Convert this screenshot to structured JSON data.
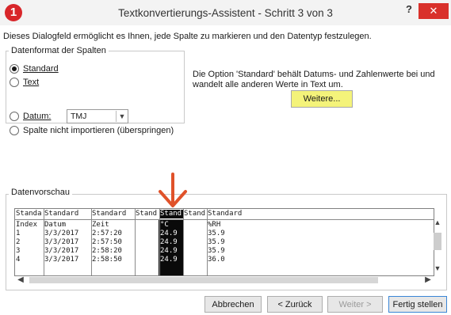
{
  "window": {
    "badge": "1",
    "title": "Textkonvertierungs-Assistent - Schritt 3 von 3",
    "help": "?",
    "close": "✕"
  },
  "description": "Dieses Dialogfeld ermöglicht es Ihnen, jede Spalte zu markieren und den Datentyp festzulegen.",
  "format_group": {
    "legend": "Datenformat der Spalten",
    "options": [
      {
        "label": "Standard",
        "selected": true
      },
      {
        "label": "Text",
        "selected": false
      },
      {
        "label": "Datum:",
        "selected": false
      },
      {
        "label": "Spalte nicht importieren (überspringen)",
        "selected": false
      }
    ],
    "date_format": "TMJ"
  },
  "info_text": "Die Option 'Standard' behält Datums- und Zahlenwerte bei und wandelt alle anderen Werte in Text um.",
  "weitere_label": "Weitere...",
  "preview": {
    "legend": "Datenvorschau",
    "headers": [
      "Standa",
      "Standard",
      "Standard",
      "Stand",
      "Stand",
      "Stand",
      "Standard"
    ],
    "rows": [
      [
        "Index",
        "Datum",
        "Zeit",
        "",
        "°C",
        "",
        "%RH"
      ],
      [
        "1",
        "3/3/2017",
        "2:57:20",
        "",
        "24.9",
        "",
        "35.9"
      ],
      [
        "2",
        "3/3/2017",
        "2:57:50",
        "",
        "24.9",
        "",
        "35.9"
      ],
      [
        "3",
        "3/3/2017",
        "2:58:20",
        "",
        "24.9",
        "",
        "35.9"
      ],
      [
        "4",
        "3/3/2017",
        "2:58:50",
        "",
        "24.9",
        "",
        "36.0"
      ]
    ]
  },
  "buttons": {
    "cancel": "Abbrechen",
    "back": "< Zurück",
    "next": "Weiter >",
    "finish": "Fertig stellen"
  },
  "colors": {
    "close_button": "#d9312b",
    "badge": "#d8262a",
    "highlight": "#f4f37a",
    "annotation_arrow": "#e0522a",
    "selected_column": "#0a0a0a"
  }
}
